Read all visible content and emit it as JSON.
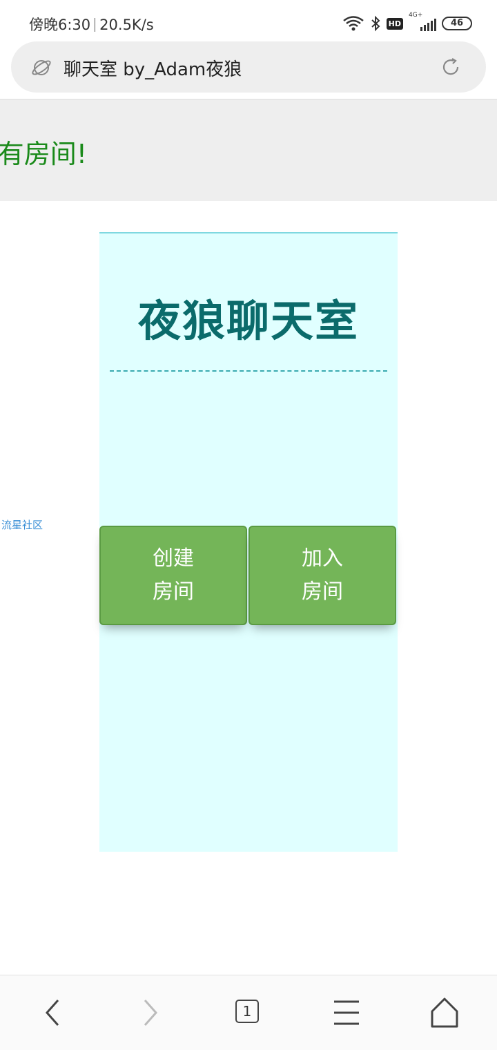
{
  "status_bar": {
    "time": "傍晚6:30",
    "speed": "20.5K/s",
    "network": "4G+",
    "hd": "HD",
    "battery": "46"
  },
  "url_bar": {
    "title": "聊天室 by_Adam夜狼"
  },
  "page": {
    "notice": "有房间!",
    "side_link": "流星社区",
    "chat_title": "夜狼聊天室",
    "buttons": [
      {
        "line1": "创建",
        "line2": "房间"
      },
      {
        "line1": "加入",
        "line2": "房间"
      }
    ]
  },
  "bottom_nav": {
    "tab_count": "1",
    "icons": [
      "back-icon",
      "forward-icon",
      "tabs-icon",
      "menu-icon",
      "home-icon"
    ]
  },
  "colors": {
    "panel_bg": "#e0ffff",
    "title": "#0b6b6b",
    "button": "#74b558",
    "notice": "#1a8a1a",
    "link": "#3a8fd6"
  }
}
